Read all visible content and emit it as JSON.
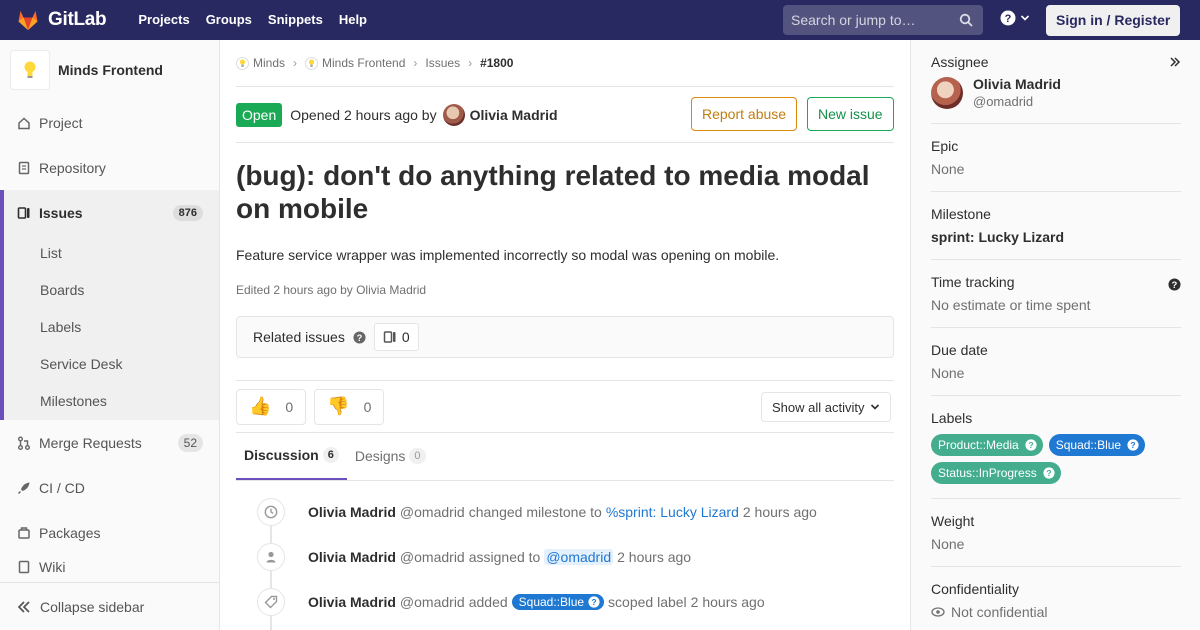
{
  "navbar": {
    "brand": "GitLab",
    "links": [
      "Projects",
      "Groups",
      "Snippets",
      "Help"
    ],
    "search_placeholder": "Search or jump to…",
    "signin": "Sign in / Register"
  },
  "sidebar": {
    "project_name": "Minds Frontend",
    "items": [
      {
        "label": "Project",
        "icon": "home-icon"
      },
      {
        "label": "Repository",
        "icon": "doc-icon"
      }
    ],
    "issues": {
      "label": "Issues",
      "count": "876",
      "sub": [
        "List",
        "Boards",
        "Labels",
        "Service Desk",
        "Milestones"
      ]
    },
    "more": [
      {
        "label": "Merge Requests",
        "count": "52",
        "icon": "merge-icon"
      },
      {
        "label": "CI / CD",
        "icon": "rocket-icon"
      },
      {
        "label": "Packages",
        "icon": "package-icon"
      }
    ],
    "partial": "Wiki",
    "collapse": "Collapse sidebar"
  },
  "breadcrumb": {
    "group": "Minds",
    "project": "Minds Frontend",
    "section": "Issues",
    "current": "#1800"
  },
  "issue": {
    "status": "Open",
    "opened": "Opened 2 hours ago by",
    "author": "Olivia Madrid",
    "report": "Report abuse",
    "new": "New issue",
    "title": "(bug): don't do anything related to media modal on mobile",
    "description": "Feature service wrapper was implemented incorrectly so modal was opening on mobile.",
    "edited": "Edited 2 hours ago by Olivia Madrid"
  },
  "related": {
    "title": "Related issues",
    "count": "0"
  },
  "awards": {
    "thumbsup": "0",
    "thumbsdown": "0",
    "activity": "Show all activity"
  },
  "tabs": [
    {
      "label": "Discussion",
      "count": "6"
    },
    {
      "label": "Designs",
      "count": "0"
    }
  ],
  "notes": [
    {
      "author": "Olivia Madrid",
      "handle": "@omadrid",
      "action": "changed milestone to",
      "link": "%sprint: Lucky Lizard",
      "time": "2 hours ago"
    },
    {
      "author": "Olivia Madrid",
      "handle": "@omadrid",
      "action": "assigned to",
      "link": "@omadrid",
      "time": "2 hours ago"
    },
    {
      "author": "Olivia Madrid",
      "handle": "@omadrid",
      "action": "added",
      "label": "Squad::Blue",
      "suffix": "scoped label",
      "time": "2 hours ago"
    }
  ],
  "right": {
    "assignee": {
      "title": "Assignee",
      "name": "Olivia Madrid",
      "handle": "@omadrid"
    },
    "epic": {
      "title": "Epic",
      "value": "None"
    },
    "milestone": {
      "title": "Milestone",
      "value": "sprint: Lucky Lizard"
    },
    "time": {
      "title": "Time tracking",
      "value": "No estimate or time spent"
    },
    "due": {
      "title": "Due date",
      "value": "None"
    },
    "labels": {
      "title": "Labels",
      "items": [
        {
          "name": "Product::Media",
          "color": "#44ad8e"
        },
        {
          "name": "Squad::Blue",
          "color": "#1f78d1"
        },
        {
          "name": "Status::InProgress",
          "color": "#44ad8e"
        }
      ]
    },
    "weight": {
      "title": "Weight",
      "value": "None"
    },
    "confidentiality": {
      "title": "Confidentiality",
      "value": "Not confidential"
    }
  },
  "colors": {
    "navbar": "#292961",
    "accent": "#6b4fbb",
    "open": "#1aaa55",
    "link": "#1f78d1"
  }
}
